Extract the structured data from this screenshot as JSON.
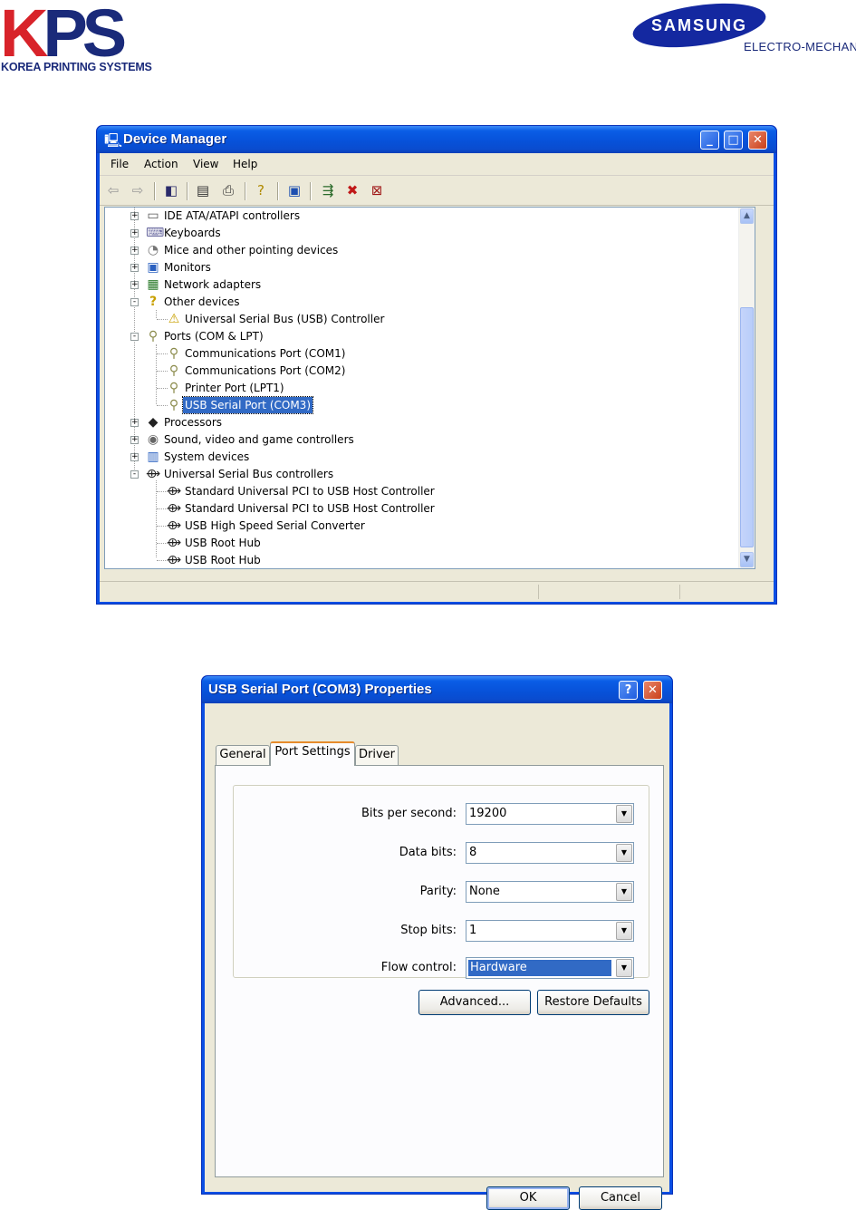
{
  "logos": {
    "kps": {
      "letters": "KPS",
      "subtitle": "KOREA PRINTING SYSTEMS"
    },
    "samsung": {
      "wordmark": "SAMSUNG",
      "subtitle": "ELECTRO-MECHANICS"
    }
  },
  "device_manager": {
    "title": "Device Manager",
    "menu": [
      "File",
      "Action",
      "View",
      "Help"
    ],
    "toolbar_icons": [
      "back-arrow-icon",
      "forward-arrow-icon",
      "show-hide-console-tree-icon",
      "properties-icon",
      "print-icon",
      "help-icon",
      "scan-hardware-icon",
      "update-driver-icon",
      "uninstall-icon",
      "disable-icon"
    ],
    "tree": [
      {
        "label": "IDE ATA/ATAPI controllers",
        "level": 0,
        "expander": "+",
        "icon": "ide-controller-icon"
      },
      {
        "label": "Keyboards",
        "level": 0,
        "expander": "+",
        "icon": "keyboard-icon"
      },
      {
        "label": "Mice and other pointing devices",
        "level": 0,
        "expander": "+",
        "icon": "mouse-icon"
      },
      {
        "label": "Monitors",
        "level": 0,
        "expander": "+",
        "icon": "monitor-icon"
      },
      {
        "label": "Network adapters",
        "level": 0,
        "expander": "+",
        "icon": "network-adapter-icon"
      },
      {
        "label": "Other devices",
        "level": 0,
        "expander": "-",
        "icon": "unknown-device-icon"
      },
      {
        "label": "Universal Serial Bus (USB) Controller",
        "level": 1,
        "icon": "warning-device-icon"
      },
      {
        "label": "Ports (COM & LPT)",
        "level": 0,
        "expander": "-",
        "icon": "port-icon"
      },
      {
        "label": "Communications Port (COM1)",
        "level": 1,
        "icon": "port-icon"
      },
      {
        "label": "Communications Port (COM2)",
        "level": 1,
        "icon": "port-icon"
      },
      {
        "label": "Printer Port (LPT1)",
        "level": 1,
        "icon": "port-icon"
      },
      {
        "label": "USB Serial Port (COM3)",
        "level": 1,
        "icon": "port-icon",
        "selected": true
      },
      {
        "label": "Processors",
        "level": 0,
        "expander": "+",
        "icon": "processor-icon"
      },
      {
        "label": "Sound, video and game controllers",
        "level": 0,
        "expander": "+",
        "icon": "sound-icon"
      },
      {
        "label": "System devices",
        "level": 0,
        "expander": "+",
        "icon": "system-device-icon"
      },
      {
        "label": "Universal Serial Bus controllers",
        "level": 0,
        "expander": "-",
        "icon": "usb-icon"
      },
      {
        "label": "Standard Universal PCI to USB Host Controller",
        "level": 1,
        "icon": "usb-icon"
      },
      {
        "label": "Standard Universal PCI to USB Host Controller",
        "level": 1,
        "icon": "usb-icon"
      },
      {
        "label": "USB High Speed Serial Converter",
        "level": 1,
        "icon": "usb-icon"
      },
      {
        "label": "USB Root Hub",
        "level": 1,
        "icon": "usb-icon"
      },
      {
        "label": "USB Root Hub",
        "level": 1,
        "icon": "usb-icon"
      }
    ]
  },
  "properties": {
    "title": "USB Serial Port (COM3) Properties",
    "tabs": [
      {
        "label": "General",
        "active": false
      },
      {
        "label": "Port Settings",
        "active": true
      },
      {
        "label": "Driver",
        "active": false
      }
    ],
    "fields": [
      {
        "label": "Bits per second:",
        "value": "19200"
      },
      {
        "label": "Data bits:",
        "value": "8"
      },
      {
        "label": "Parity:",
        "value": "None"
      },
      {
        "label": "Stop bits:",
        "value": "1"
      },
      {
        "label": "Flow control:",
        "value": "Hardware",
        "focused": true
      }
    ],
    "advanced_label": "Advanced...",
    "restore_label": "Restore Defaults",
    "ok_label": "OK",
    "cancel_label": "Cancel"
  },
  "colors": {
    "title_blue": "#0a5de6",
    "selection": "#316ac5",
    "face": "#ece9d8",
    "tab_accent": "#e68b2c"
  }
}
